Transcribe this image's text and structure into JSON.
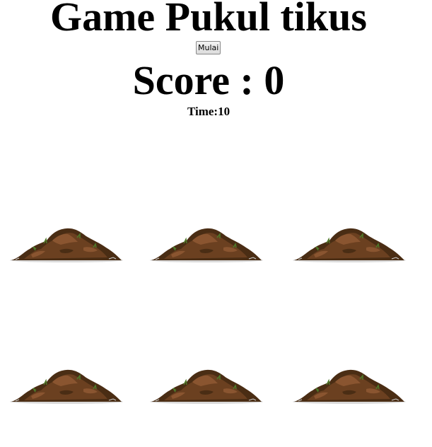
{
  "title": "Game Pukul tikus",
  "start_button": "Mulai",
  "score": {
    "label": "Score :",
    "value": 0
  },
  "time": {
    "label": "Time:",
    "value": 10
  },
  "board": {
    "holes": [
      {
        "row": 1,
        "col": 1
      },
      {
        "row": 1,
        "col": 2
      },
      {
        "row": 1,
        "col": 3
      },
      {
        "row": 2,
        "col": 1
      },
      {
        "row": 2,
        "col": 2
      },
      {
        "row": 2,
        "col": 3
      }
    ]
  },
  "colors": {
    "dirt_dark": "#4a2d14",
    "dirt_mid": "#6b4020",
    "dirt_light": "#8a5530",
    "grass": "#4f7a2a"
  }
}
